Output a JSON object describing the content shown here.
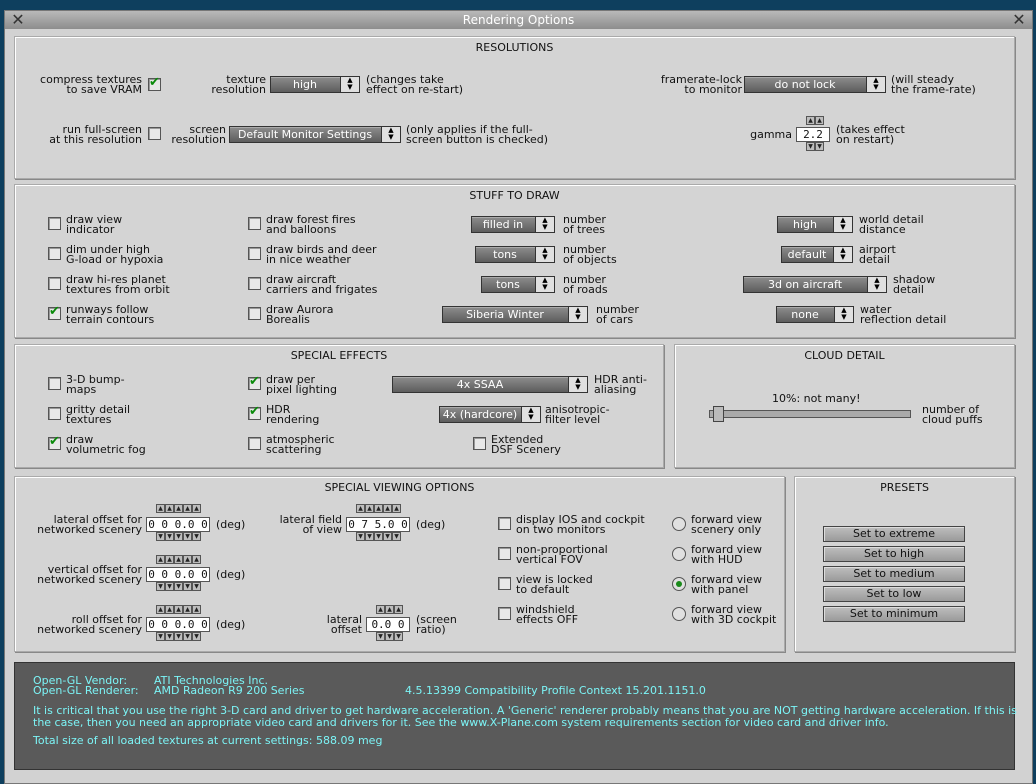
{
  "window": {
    "title": "Rendering Options"
  },
  "resolutions": {
    "title": "RESOLUTIONS",
    "compress_label": [
      "compress textures",
      "to save VRAM"
    ],
    "compress_checked": true,
    "texture_label": [
      "texture",
      "resolution"
    ],
    "texture_value": "high",
    "texture_note": [
      "(changes take",
      "effect on re-start)"
    ],
    "framerate_label": [
      "framerate-lock",
      "to monitor"
    ],
    "framerate_value": "do not lock",
    "framerate_note": [
      "(will steady",
      "the frame-rate)"
    ],
    "fullscreen_label": [
      "run full-screen",
      "at this resolution"
    ],
    "fullscreen_checked": false,
    "screen_label": [
      "screen",
      "resolution"
    ],
    "screen_value": "Default Monitor Settings",
    "screen_note": [
      "(only applies if the full-",
      "screen button is checked)"
    ],
    "gamma_label": "gamma",
    "gamma_value": "2.2",
    "gamma_note": [
      "(takes effect",
      "on restart)"
    ]
  },
  "stuff": {
    "title": "STUFF TO DRAW",
    "checks": [
      {
        "label": [
          "draw view",
          "indicator"
        ],
        "checked": false
      },
      {
        "label": [
          "dim under high",
          "G-load or hypoxia"
        ],
        "checked": false
      },
      {
        "label": [
          "draw hi-res planet",
          "textures from orbit"
        ],
        "checked": false
      },
      {
        "label": [
          "runways follow",
          "terrain contours"
        ],
        "checked": true
      },
      {
        "label": [
          "draw forest fires",
          "and balloons"
        ],
        "checked": false
      },
      {
        "label": [
          "draw birds and deer",
          "in nice weather"
        ],
        "checked": false
      },
      {
        "label": [
          "draw aircraft",
          "carriers and frigates"
        ],
        "checked": false
      },
      {
        "label": [
          "draw Aurora",
          "Borealis"
        ],
        "checked": false
      }
    ],
    "drops_mid": [
      {
        "value": "filled in",
        "label": [
          "number",
          "of trees"
        ]
      },
      {
        "value": "tons",
        "label": [
          "number",
          "of objects"
        ]
      },
      {
        "value": "tons",
        "label": [
          "number",
          "of roads"
        ]
      },
      {
        "value": "Siberia Winter",
        "label": [
          "number",
          "of cars"
        ]
      }
    ],
    "drops_right": [
      {
        "value": "high",
        "label": [
          "world detail",
          "distance"
        ]
      },
      {
        "value": "default",
        "label": [
          "airport",
          "detail"
        ]
      },
      {
        "value": "3d on aircraft",
        "label": [
          "shadow",
          "detail"
        ]
      },
      {
        "value": "none",
        "label": [
          "water",
          "reflection detail"
        ]
      }
    ]
  },
  "effects": {
    "title": "SPECIAL EFFECTS",
    "checks": [
      {
        "label": [
          "3-D bump-",
          "maps"
        ],
        "checked": false
      },
      {
        "label": [
          "gritty detail",
          "textures"
        ],
        "checked": false
      },
      {
        "label": [
          "draw",
          "volumetric fog"
        ],
        "checked": true
      },
      {
        "label": [
          "draw per",
          "pixel lighting"
        ],
        "checked": true
      },
      {
        "label": [
          "HDR",
          "rendering"
        ],
        "checked": true
      },
      {
        "label": [
          "atmospheric",
          "scattering"
        ],
        "checked": false
      },
      {
        "label": [
          "Extended",
          "DSF Scenery"
        ],
        "checked": false
      }
    ],
    "hdr_value": "4x SSAA",
    "hdr_label": [
      "HDR anti-",
      "aliasing"
    ],
    "aniso_value": "4x (hardcore)",
    "aniso_label": [
      "anisotropic-",
      "filter level"
    ]
  },
  "cloud": {
    "title": "CLOUD DETAIL",
    "value_text": "10%: not many!",
    "level": 0.02,
    "label": [
      "number of",
      "cloud puffs"
    ]
  },
  "viewing": {
    "title": "SPECIAL VIEWING OPTIONS",
    "lateral_offset": {
      "label": [
        "lateral offset for",
        "networked scenery"
      ],
      "value": "0 0 0.0 0",
      "unit": "(deg)"
    },
    "vertical_offset": {
      "label": [
        "vertical offset for",
        "networked scenery"
      ],
      "value": "0 0 0.0 0",
      "unit": "(deg)"
    },
    "roll_offset": {
      "label": [
        "roll offset for",
        "networked scenery"
      ],
      "value": "0 0 0.0 0",
      "unit": "(deg)"
    },
    "lateral_fov": {
      "label": [
        "lateral field",
        "of view"
      ],
      "value": "0 7 5.0 0",
      "unit": "(deg)"
    },
    "lateral_off2": {
      "label": [
        "lateral",
        "offset"
      ],
      "value": "0.0 0",
      "unit": [
        "(screen",
        "ratio)"
      ]
    },
    "checks": [
      {
        "label": [
          "display IOS and cockpit",
          "on two monitors"
        ],
        "checked": false
      },
      {
        "label": [
          "non-proportional",
          "vertical FOV"
        ],
        "checked": false
      },
      {
        "label": [
          "view is locked",
          "to default"
        ],
        "checked": false
      },
      {
        "label": [
          "windshield",
          "effects OFF"
        ],
        "checked": false
      }
    ],
    "radios": [
      {
        "label": [
          "forward view",
          "scenery only"
        ],
        "selected": false
      },
      {
        "label": [
          "forward view",
          "with HUD"
        ],
        "selected": false
      },
      {
        "label": [
          "forward view",
          "with panel"
        ],
        "selected": true
      },
      {
        "label": [
          "forward view",
          "with 3D cockpit"
        ],
        "selected": false
      }
    ]
  },
  "presets": {
    "title": "PRESETS",
    "buttons": [
      "Set to extreme",
      "Set to high",
      "Set to medium",
      "Set to low",
      "Set to minimum"
    ]
  },
  "info": {
    "vendor_label": "Open-GL Vendor:",
    "vendor": "ATI Technologies Inc.",
    "renderer_label": "Open-GL Renderer:",
    "renderer": "AMD Radeon R9 200 Series",
    "version": "4.5.13399 Compatibility Profile Context 15.201.1151.0",
    "warning1": "It is critical that you use the right 3-D card and driver to get hardware acceleration. A 'Generic' renderer probably means that you are NOT getting hardware acceleration. If this is",
    "warning2": "the case, then you need an appropriate video card and drivers for it. See the www.X-Plane.com system requirements section for video card and driver info.",
    "textures": "Total size of all loaded textures at current settings: 588.09 meg"
  }
}
